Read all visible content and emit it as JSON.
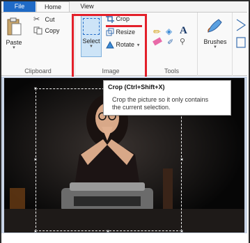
{
  "tabs": [
    {
      "label": "File"
    },
    {
      "label": "Home"
    },
    {
      "label": "View"
    }
  ],
  "clipboard": {
    "group_label": "Clipboard",
    "paste": "Paste",
    "cut": "Cut",
    "copy": "Copy"
  },
  "image_group": {
    "group_label": "Image",
    "select": "Select",
    "crop": "Crop",
    "resize": "Resize",
    "rotate": "Rotate"
  },
  "tools": {
    "group_label": "Tools",
    "text_tool_glyph": "A"
  },
  "brushes": {
    "label": "Brushes"
  },
  "tooltip": {
    "title": "Crop (Ctrl+Shift+X)",
    "line1": "Crop the picture so it only contains",
    "line2": "the current selection."
  },
  "colors": {
    "accent": "#1f6ac6",
    "highlight": "#e3202a",
    "workspace": "#c9d4e6"
  }
}
